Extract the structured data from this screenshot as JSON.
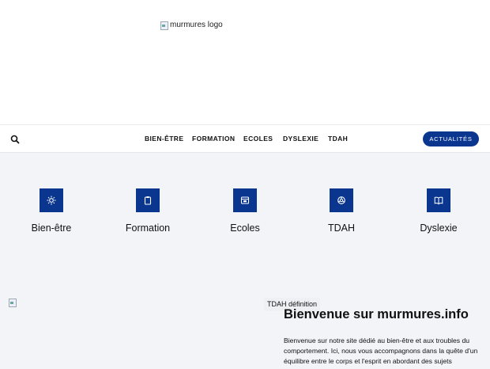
{
  "header": {
    "logo_alt": "murmures logo"
  },
  "navbar": {
    "search_icon": "search-icon",
    "links": [
      "BIEN-ÊTRE",
      "FORMATION",
      "ECOLES",
      "DYSLEXIE",
      "TDAH"
    ],
    "cta_label": "ACTUALITÉS"
  },
  "categories": {
    "items": [
      {
        "label": "Bien-être",
        "icon": "sun-icon"
      },
      {
        "label": "Formation",
        "icon": "clipboard-icon"
      },
      {
        "label": "Ecoles",
        "icon": "school-icon"
      },
      {
        "label": "TDAH",
        "icon": "brain-icon"
      },
      {
        "label": "Dyslexie",
        "icon": "book-icon"
      }
    ]
  },
  "content": {
    "caption": "TDAH définition",
    "title": "Bienvenue sur murmures.info",
    "intro": "Bienvenue sur notre site dédié au bien-être et aux troubles du comportement. Ici, nous vous accompagnons dans la quête d'un équilibre entre le corps et l'esprit en abordant des sujets essentiels"
  },
  "colors": {
    "accent": "#0a3690",
    "section_bg": "#f2f4f8"
  }
}
